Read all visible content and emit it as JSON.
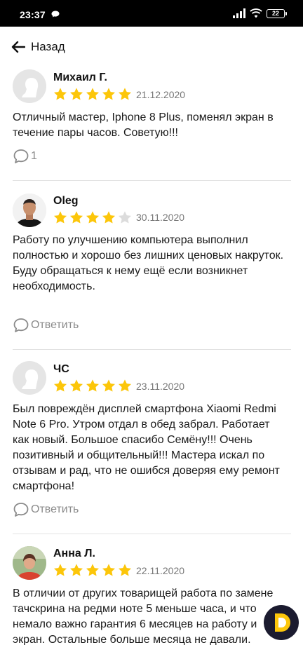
{
  "status_bar": {
    "time": "23:37",
    "battery": "22",
    "icons": [
      "message-icon",
      "signal-icon",
      "wifi-icon",
      "battery-icon"
    ]
  },
  "nav": {
    "back_label": "Назад",
    "icon": "arrow-left-icon"
  },
  "colors": {
    "star_filled": "#fcc60a",
    "star_empty": "#dcdcdc",
    "fab_dark": "#1b1b2f",
    "fab_accent": "#fcc60a"
  },
  "reviews": [
    {
      "author": "Михаил Г.",
      "rating": 5,
      "date": "21.12.2020",
      "text": "Отличный мастер, Iphone 8 Plus, поменял экран в течение пары часов. Советую!!!",
      "action_label": "1",
      "avatar": "default-avatar-icon"
    },
    {
      "author": "Oleg",
      "rating": 4,
      "date": "30.11.2020",
      "text": "Работу по улучшению компьютера выполнил полностью и хорошо без лишних ценовых накруток.\nБуду обращаться к нему ещё если возникнет необходимость.",
      "action_label": "Ответить",
      "avatar": "user-photo"
    },
    {
      "author": "ЧС",
      "rating": 5,
      "date": "23.11.2020",
      "text": "Был повреждён дисплей смартфона Xiaomi Redmi Note 6 Pro. Утром отдал в обед забрал. Работает как новый. Большое спасибо Семёну!!! Очень позитивный и общительный!!! Мастера искал по отзывам и рад, что не ошибся доверяя ему ремонт смартфона!",
      "action_label": "Ответить",
      "avatar": "default-avatar-icon"
    },
    {
      "author": "Анна Л.",
      "rating": 5,
      "date": "22.11.2020",
      "text": "В отличии от других товарищей работа по замене тачскрина на редми ноте 5 меньше часа, и что немало важно гарантия 6 месяцев на работу и экран. Остальные больше месяца не давали.",
      "avatar": "user-photo"
    }
  ]
}
